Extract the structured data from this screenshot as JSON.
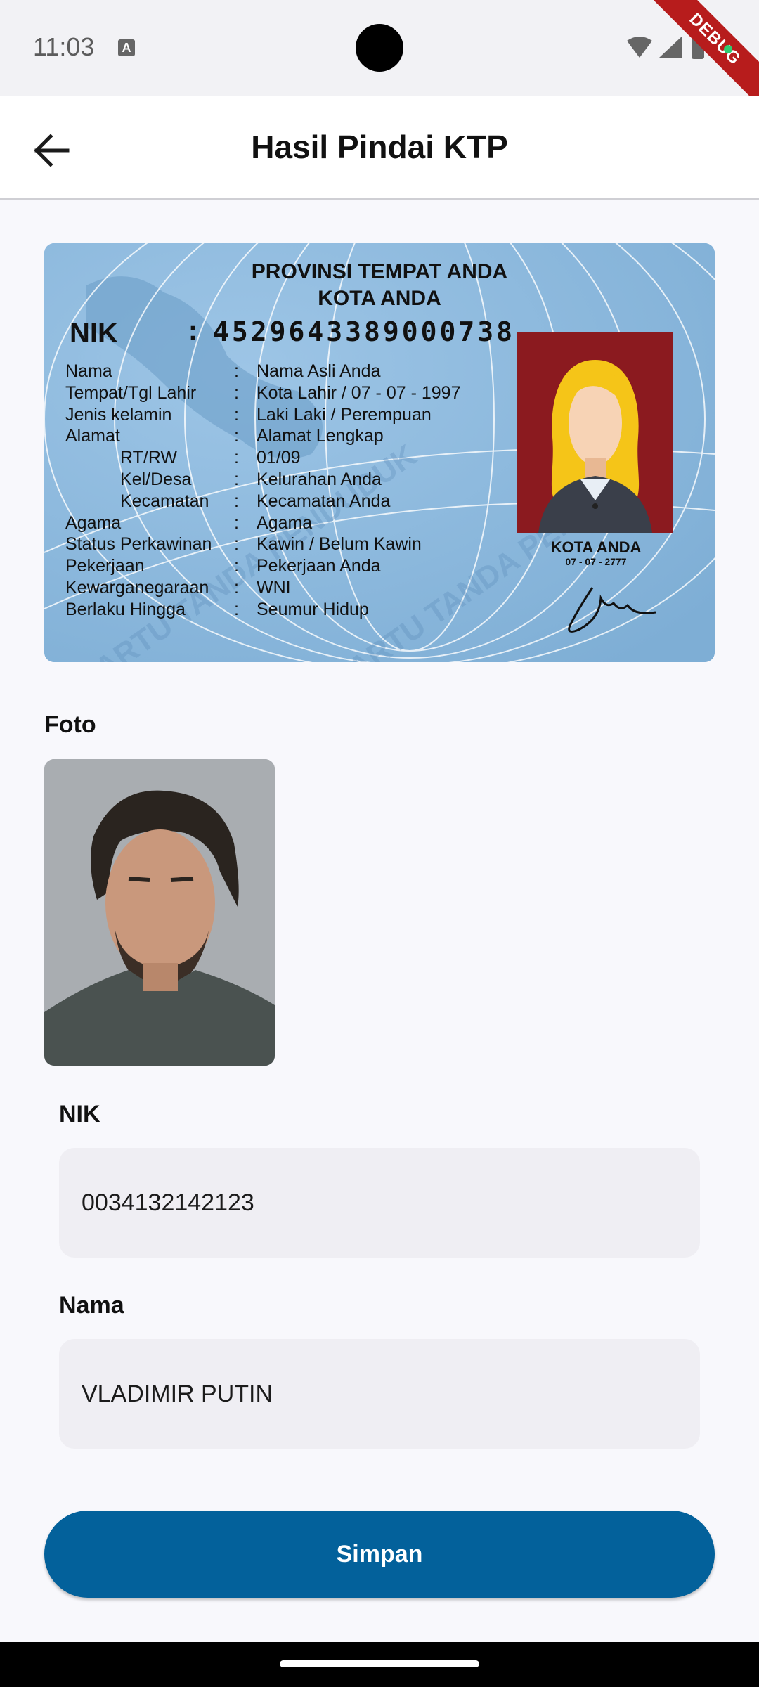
{
  "status_bar": {
    "time": "11:03",
    "notification_icon": "A",
    "debug_label": "DEBUG"
  },
  "app_bar": {
    "title": "Hasil Pindai KTP"
  },
  "ktp_card": {
    "province": "PROVINSI TEMPAT ANDA",
    "city": "KOTA ANDA",
    "nik_label": "NIK",
    "nik_colon": ":",
    "nik_value": "4529643389000738",
    "rows": [
      {
        "label": "Nama",
        "value": "Nama Asli Anda"
      },
      {
        "label": "Tempat/Tgl Lahir",
        "value": "Kota Lahir / 07 - 07 - 1997"
      },
      {
        "label": "Jenis kelamin",
        "value": "Laki Laki / Perempuan"
      },
      {
        "label": "Alamat",
        "value": "Alamat Lengkap"
      },
      {
        "label": "RT/RW",
        "value": "01/09"
      },
      {
        "label": "Kel/Desa",
        "value": "Kelurahan Anda"
      },
      {
        "label": "Kecamatan",
        "value": "Kecamatan Anda"
      },
      {
        "label": "Agama",
        "value": "Agama"
      },
      {
        "label": "Status Perkawinan",
        "value": "Kawin / Belum Kawin"
      },
      {
        "label": "Pekerjaan",
        "value": "Pekerjaan Anda"
      },
      {
        "label": "Kewarganegaraan",
        "value": "WNI"
      },
      {
        "label": "Berlaku Hingga",
        "value": "Seumur Hidup"
      }
    ],
    "photo_city": "KOTA ANDA",
    "photo_date": "07 - 07 - 2777",
    "watermark": "KARTU TANDA PENDUDUK"
  },
  "photo_section": {
    "label": "Foto"
  },
  "form": {
    "nik_label": "NIK",
    "nik_value": "0034132142123",
    "nama_label": "Nama",
    "nama_value": "VLADIMIR PUTIN"
  },
  "save_button": {
    "label": "Simpan"
  },
  "colors": {
    "primary": "#03619b",
    "field_bg": "#efeef3",
    "background": "#f8f8fc"
  }
}
